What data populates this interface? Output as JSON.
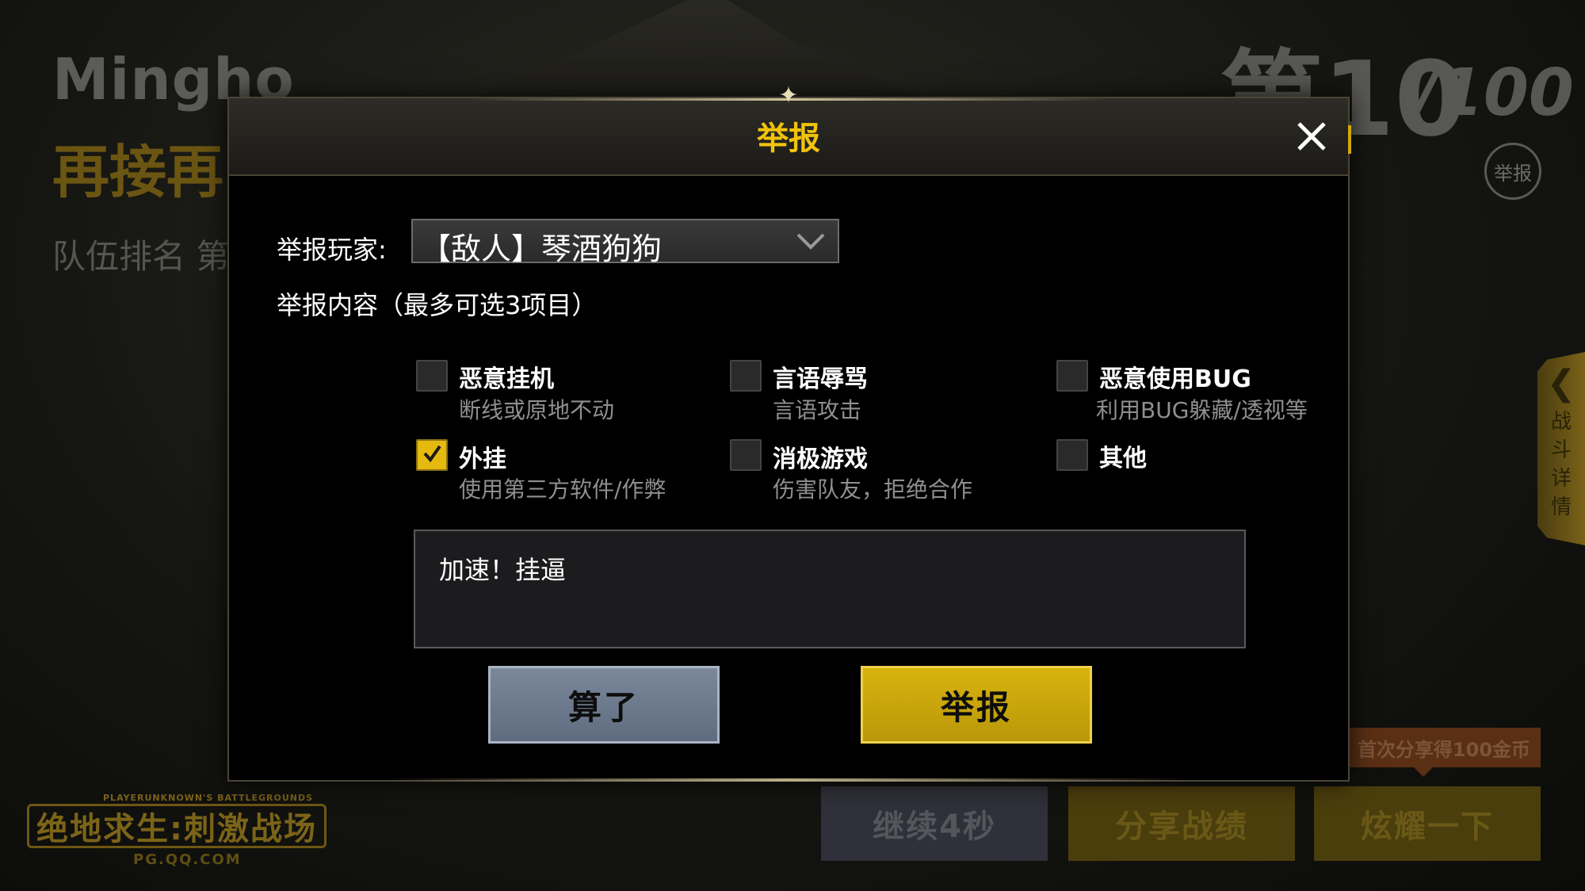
{
  "background": {
    "player_name": "Mingho",
    "encourage_text": "再接再",
    "team_rank_text": "队伍排名 第",
    "rank_prefix": "第10",
    "rank_total": "/100",
    "report_circle_label": "举报",
    "side_tab_label": "战斗详情",
    "logo_small": "PLAYERUNKNOWN'S BATTLEGROUNDS",
    "logo_main": "绝地求生:刺激战场",
    "logo_url": "PG.QQ.COM",
    "share_bonus": "首次分享得100金币",
    "buttons": {
      "continue": "继续4秒",
      "share": "分享战绩",
      "show_off": "炫耀一下"
    }
  },
  "dialog": {
    "title": "举报",
    "close_icon": "close-icon",
    "player_label": "举报玩家:",
    "player_selected": "【敌人】琴酒狗狗",
    "content_label": "举报内容（最多可选3项目）",
    "options": [
      {
        "title": "恶意挂机",
        "desc": "断线或原地不动",
        "checked": false
      },
      {
        "title": "言语辱骂",
        "desc": "言语攻击",
        "checked": false
      },
      {
        "title": "恶意使用BUG",
        "desc": "利用BUG躲藏/透视等",
        "checked": false
      },
      {
        "title": "外挂",
        "desc": "使用第三方软件/作弊",
        "checked": true
      },
      {
        "title": "消极游戏",
        "desc": "伤害队友，拒绝合作",
        "checked": false
      },
      {
        "title": "其他",
        "desc": "",
        "checked": false
      }
    ],
    "note_text": "加速！挂逼",
    "cancel_label": "算了",
    "submit_label": "举报"
  },
  "colors": {
    "accent_yellow": "#e5b90e",
    "title_yellow": "#f1c30b",
    "cancel_blue_gray": "#6f7c90"
  }
}
